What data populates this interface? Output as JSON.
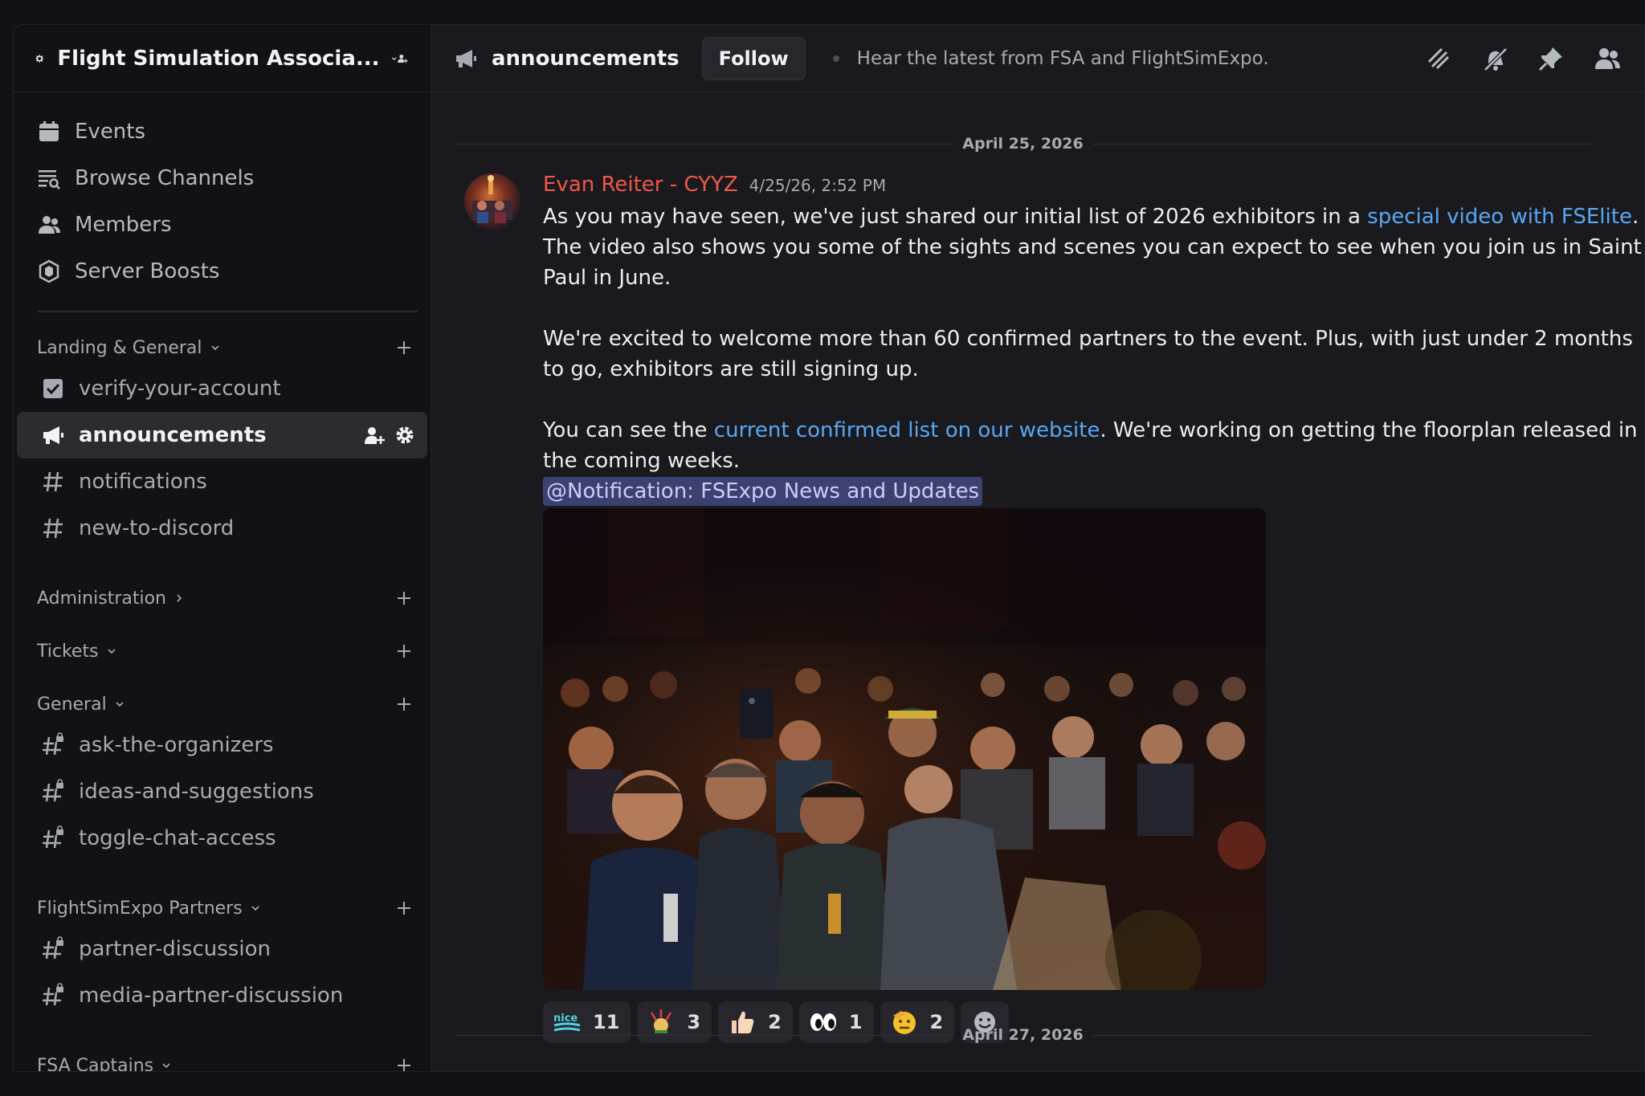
{
  "server": {
    "name": "Flight Simulation Associa..."
  },
  "nav": [
    {
      "label": "Events",
      "icon": "calendar-icon"
    },
    {
      "label": "Browse Channels",
      "icon": "browse-channels-icon"
    },
    {
      "label": "Members",
      "icon": "members-icon"
    },
    {
      "label": "Server Boosts",
      "icon": "boost-icon"
    }
  ],
  "categories": {
    "landing": {
      "label": "Landing & General"
    },
    "administration": {
      "label": "Administration"
    },
    "tickets": {
      "label": "Tickets"
    },
    "general": {
      "label": "General"
    },
    "partners": {
      "label": "FlightSimExpo Partners"
    },
    "captains": {
      "label": "FSA Captains"
    }
  },
  "channels": {
    "landing": [
      "verify-your-account",
      "announcements",
      "notifications",
      "new-to-discord"
    ],
    "general": [
      "ask-the-organizers",
      "ideas-and-suggestions",
      "toggle-chat-access"
    ],
    "partners": [
      "partner-discussion",
      "media-partner-discussion"
    ]
  },
  "header": {
    "channel": "announcements",
    "follow_label": "Follow",
    "topic": "Hear the latest from FSA and FlightSimExpo."
  },
  "dates": {
    "first": "April 25, 2026",
    "second": "April 27, 2026"
  },
  "message": {
    "author": "Evan Reiter - CYYZ",
    "timestamp": "4/25/26, 2:52 PM",
    "author_color": "#f0574a",
    "p1_a": "As you may have seen, we've just shared our initial list of 2026 exhibitors in a ",
    "p1_link": "special video with FSElite",
    "p1_b": ". The video also shows you some of the sights and scenes you can expect to see when you join us in Saint Paul in June.",
    "p2": "We're excited to welcome more than 60 confirmed partners to the event. Plus, with just under 2 months to go, exhibitors are still signing up.",
    "p3_a": "You can see the ",
    "p3_link": "current confirmed list on our website",
    "p3_b": ". We're working on getting the floorplan released in the coming weeks.",
    "mention": "@Notification: FSExpo News and Updates",
    "link_color": "#59a7f4"
  },
  "reactions": [
    {
      "emoji": "nice-emoji",
      "count": "11"
    },
    {
      "emoji": "celebration-emoji",
      "count": "3"
    },
    {
      "emoji": "thumbs-up-emoji",
      "count": "2"
    },
    {
      "emoji": "eyes-emoji",
      "count": "1"
    },
    {
      "emoji": "saluting-face-emoji",
      "count": "2"
    }
  ]
}
